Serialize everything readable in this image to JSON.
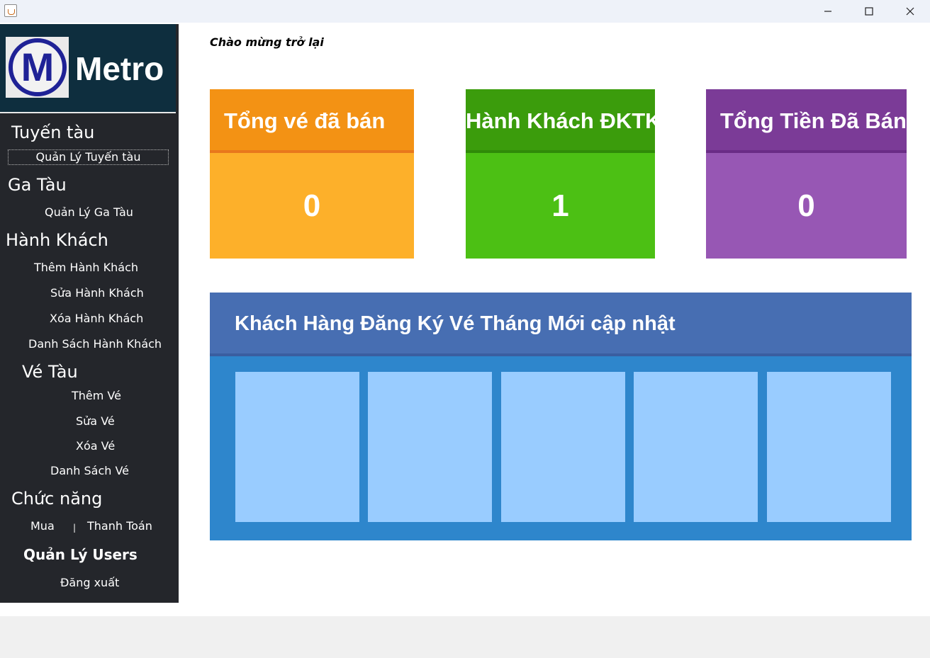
{
  "window": {
    "controls": [
      "minimize-icon",
      "maximize-icon",
      "close-icon"
    ]
  },
  "sidebar": {
    "brand": "Metro",
    "logo_letter": "M",
    "sections": {
      "tuyen_tau": {
        "title": "Tuyến tàu",
        "items": [
          "Quản Lý Tuyến tàu"
        ]
      },
      "ga_tau": {
        "title": "Ga Tàu",
        "items": [
          "Quản Lý Ga Tàu"
        ]
      },
      "hanh_khach": {
        "title": "Hành Khách",
        "items": [
          "Thêm Hành Khách",
          "Sửa Hành Khách",
          "Xóa Hành Khách",
          "Danh Sách Hành Khách"
        ]
      },
      "ve_tau": {
        "title": "Vé Tàu",
        "items": [
          "Thêm Vé",
          "Sửa Vé",
          "Xóa Vé",
          "Danh Sách Vé"
        ]
      },
      "chuc_nang": {
        "title": "Chức năng",
        "items": [
          "Mua",
          "Thanh Toán"
        ],
        "separator": "|"
      }
    },
    "users": "Quản Lý Users",
    "logout": "Đăng xuất"
  },
  "main": {
    "welcome": "Chào mừng trở lại",
    "cards": [
      {
        "title": "Tổng vé đã bán",
        "value": "0",
        "head_color": "#f39214",
        "body_color": "#fdb02a",
        "rule_color": "#e8781c"
      },
      {
        "title": "Hành Khách ĐKTK",
        "value": "1",
        "head_color": "#3b9c0c",
        "body_color": "#4cc014",
        "rule_color": "#2f8a08"
      },
      {
        "title": "Tổng Tiền Đã Bán",
        "value": "0",
        "head_color": "#7b3b97",
        "body_color": "#9757b4",
        "rule_color": "#6a2c86"
      }
    ],
    "panel": {
      "title": "Khách Hàng Đăng Ký Vé Tháng Mới cập nhật",
      "slots": 5
    }
  }
}
